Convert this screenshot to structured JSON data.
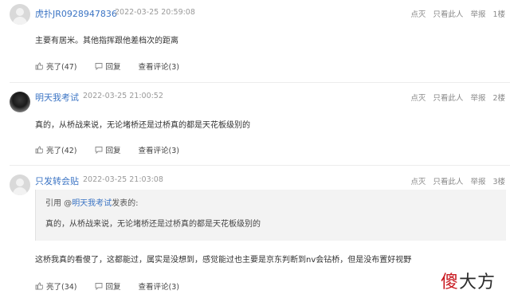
{
  "posts": [
    {
      "username": "虎扑JR0928947836",
      "time": "2022-03-25 20:59:08",
      "actions": [
        "点灭",
        "只看此人",
        "举报",
        "1楼"
      ],
      "content": "主要有居米。其他指挥跟他差档次的距离",
      "footer": {
        "light": "亮了(47)",
        "reply": "回复",
        "comments": "查看评论(3)"
      }
    },
    {
      "username": "明天我考试",
      "time": "2022-03-25 21:00:52",
      "actions": [
        "点灭",
        "只看此人",
        "举报",
        "2楼"
      ],
      "content": "真的，从桥战来说，无论堵桥还是过桥真的都是天花板级别的",
      "footer": {
        "light": "亮了(42)",
        "reply": "回复",
        "comments": "查看评论(3)"
      }
    },
    {
      "username": "只发转会贴",
      "time": "2022-03-25 21:03:08",
      "actions": [
        "点灭",
        "只看此人",
        "举报",
        "3楼"
      ],
      "quote": {
        "prefix": "引用 @",
        "author": "明天我考试",
        "suffix": "发表的:",
        "text": "真的，从桥战来说，无论堵桥还是过桥真的都是天花板级别的"
      },
      "content": "这桥我真的看傻了，这都能过，属实是没想到，感觉能过也主要是京东判断到nv会钻桥，但是没布置好视野",
      "footer": {
        "light": "亮了(34)",
        "reply": "回复",
        "comments": "查看评论(3)"
      }
    }
  ],
  "watermark": {
    "first": "傻",
    "rest": "大方"
  }
}
